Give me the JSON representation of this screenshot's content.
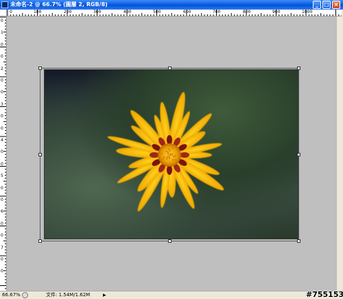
{
  "window": {
    "title": "未命名-2 @ 66.7% (圖層 2, RGB/8)",
    "buttons": {
      "minimize": "_",
      "maximize": "□",
      "close": "×"
    }
  },
  "rulers": {
    "horizontal_labels": [
      "0",
      "100",
      "200",
      "300",
      "400",
      "500",
      "600",
      "700",
      "800",
      "900",
      "1000"
    ],
    "vertical_labels": [
      "0",
      "1",
      "0",
      "0",
      "2",
      "0",
      "0",
      "3",
      "0",
      "0",
      "4",
      "0",
      "0",
      "5",
      "0",
      "0",
      "6",
      "0",
      "0",
      "7",
      "0",
      "0"
    ]
  },
  "status": {
    "zoom": "66.67%",
    "doc_info": "文件: 1.54M/1.62M",
    "arrow": "▶"
  },
  "watermark": "#755153",
  "colors": {
    "petal": "#f5c518",
    "petal_edge": "#f0a800",
    "center_ring": "#8b1a10",
    "disc": "#e8a100",
    "canvas_bg": "#bfbfbf"
  }
}
